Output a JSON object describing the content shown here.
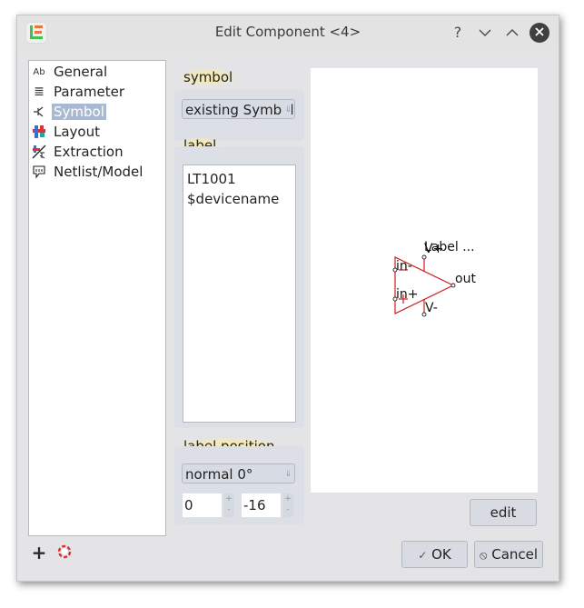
{
  "window": {
    "title": "Edit Component <4>",
    "app_icon": "app-logo-icon",
    "buttons": {
      "help": "?",
      "minimize": "⌄",
      "maximize": "⌃",
      "close": "✕"
    }
  },
  "nav": {
    "items": [
      {
        "label": "General",
        "icon": "Ab"
      },
      {
        "label": "Parameter",
        "icon": "≣"
      },
      {
        "label": "Symbol",
        "icon": "⊣",
        "selected": true
      },
      {
        "label": "Layout",
        "icon": "▦"
      },
      {
        "label": "Extraction",
        "icon": "⩘"
      },
      {
        "label": "Netlist/Model",
        "icon": "⎔"
      }
    ]
  },
  "symbol_group": {
    "title": "symbol",
    "combo_value": "existing Symbol",
    "combo_display": "existing Symt"
  },
  "label_group": {
    "title": "label",
    "lines": [
      "LT1001",
      "$devicename"
    ]
  },
  "label_position_group": {
    "title": "label position",
    "orientation": "normal 0°",
    "x": "0",
    "y": "-16"
  },
  "preview": {
    "label_text": "Label ...",
    "pins": {
      "in_minus": "in-",
      "in_plus": "in+",
      "out": "out",
      "v_plus": "V+",
      "v_minus": "V-"
    },
    "stroke_color": "#cc1f1f"
  },
  "buttons": {
    "edit": "edit",
    "ok": "OK",
    "cancel": "Cancel",
    "ok_icon": "✓",
    "cancel_icon": "⦸"
  },
  "bottom_tools": {
    "add": "+",
    "help_icon": "lifebuoy"
  }
}
